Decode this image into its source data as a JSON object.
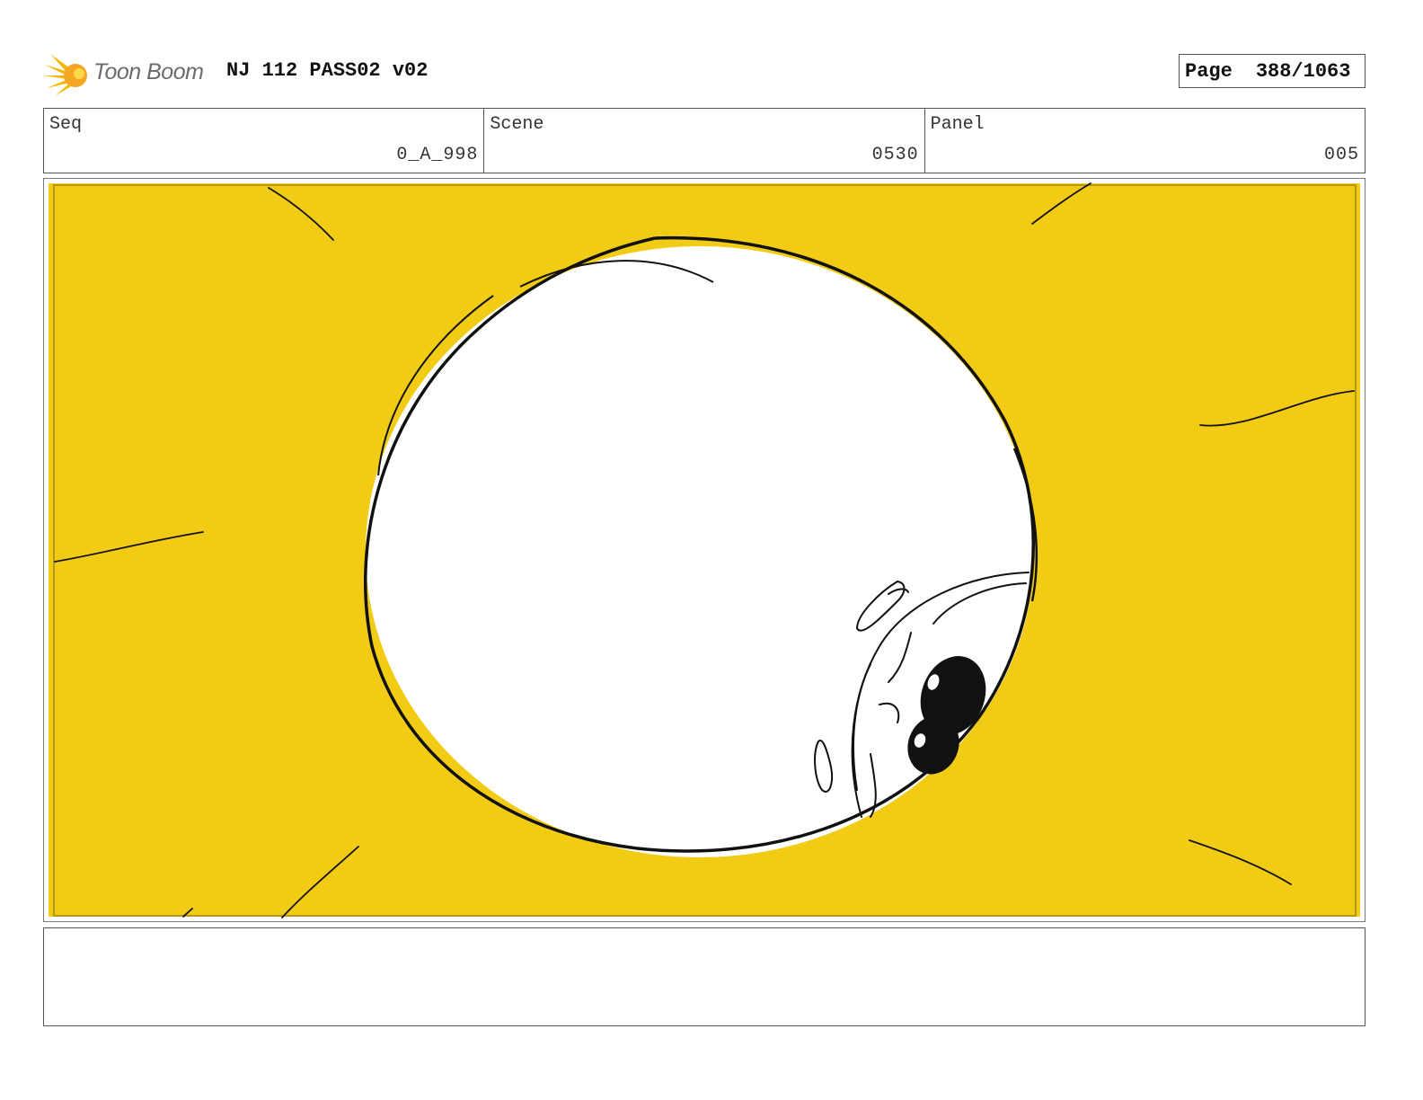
{
  "header": {
    "logo_text": "Toon Boom",
    "title": "NJ 112 PASS02 v02",
    "page_label": "Page",
    "page_value": "388/1063"
  },
  "info": {
    "seq_label": "Seq",
    "seq_value": "0_A_998",
    "scene_label": "Scene",
    "scene_value": "0530",
    "panel_label": "Panel",
    "panel_value": "005"
  },
  "colors": {
    "background_yellow": "#F2CB14",
    "ink": "#111111",
    "logo_orange": "#F5A623"
  }
}
